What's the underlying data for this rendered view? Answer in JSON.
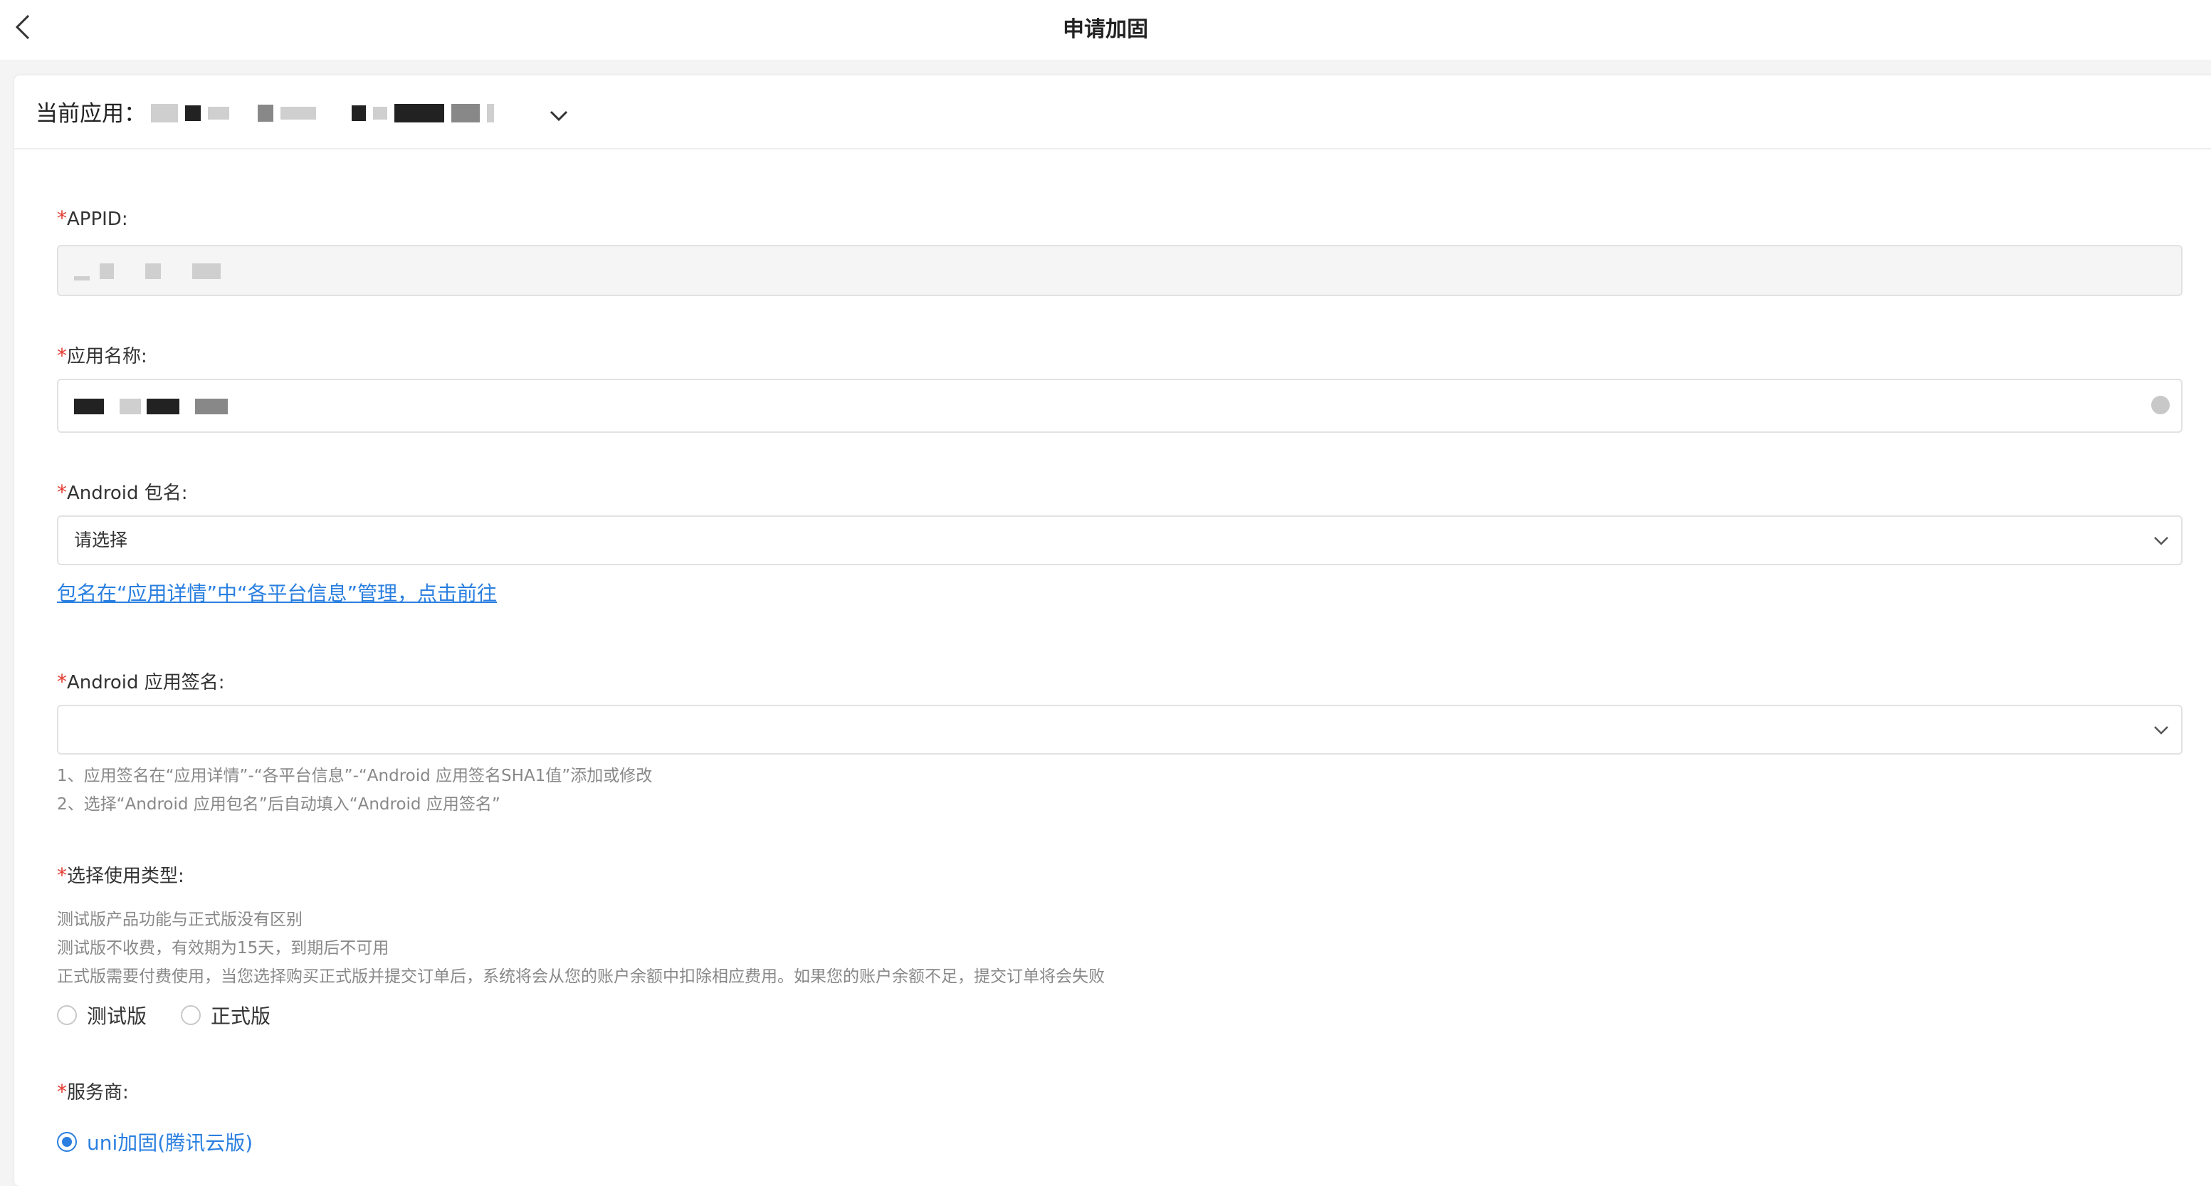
{
  "header": {
    "title": "申请加固"
  },
  "app_selector": {
    "label": "当前应用："
  },
  "form": {
    "appid": {
      "label": "APPID:"
    },
    "app_name": {
      "label": "应用名称:"
    },
    "android_package": {
      "label": "Android 包名:",
      "placeholder": "请选择",
      "link_text": "包名在“应用详情”中“各平台信息”管理，点击前往"
    },
    "android_signature": {
      "label": "Android 应用签名:",
      "hints": [
        "1、应用签名在“应用详情”-“各平台信息”-“Android 应用签名SHA1值”添加或修改",
        "2、选择“Android 应用包名”后自动填入“Android 应用签名”"
      ]
    },
    "usage_type": {
      "label": "选择使用类型:",
      "descriptions": [
        "测试版产品功能与正式版没有区别",
        "测试版不收费，有效期为15天，到期后不可用",
        "正式版需要付费使用，当您选择购买正式版并提交订单后，系统将会从您的账户余额中扣除相应费用。如果您的账户余额不足，提交订单将会失败"
      ],
      "options": [
        {
          "label": "测试版",
          "checked": false
        },
        {
          "label": "正式版",
          "checked": false
        }
      ]
    },
    "provider": {
      "label": "服务商:",
      "options": [
        {
          "label": "uni加固(腾讯云版)",
          "checked": true
        }
      ]
    }
  },
  "required_mark": "*",
  "colors": {
    "accent": "#2a7fe0",
    "required": "#e43d33",
    "hint": "#888888"
  },
  "icons": {
    "back": "chevron-left-icon",
    "app_toggle": "chevron-down-icon",
    "clear": "clear-circle-icon",
    "select": "chevron-down-icon"
  }
}
